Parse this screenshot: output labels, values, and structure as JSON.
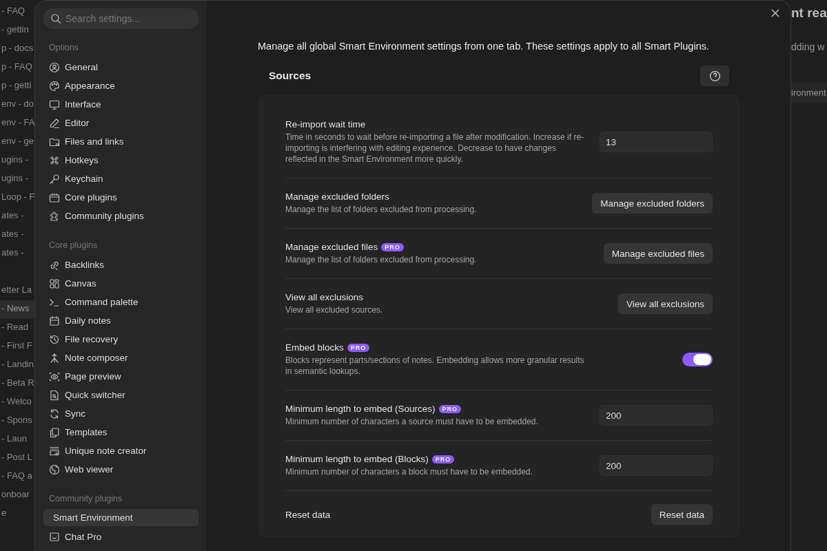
{
  "background_left": {
    "groups": [
      {
        "items": [
          {
            "label": "- FAQ",
            "selected": false
          },
          {
            "label": "- gettin",
            "selected": false
          },
          {
            "label": "p - docs",
            "selected": false
          },
          {
            "label": "p - FAQ",
            "selected": false
          },
          {
            "label": "p - getti",
            "selected": false
          },
          {
            "label": "env - do",
            "selected": false
          },
          {
            "label": "env - FA",
            "selected": false
          },
          {
            "label": "env - ge",
            "selected": false
          },
          {
            "label": "ugins -",
            "selected": false
          },
          {
            "label": "ugins -",
            "selected": false
          },
          {
            "label": "Loop - F",
            "selected": false
          },
          {
            "label": "ates -",
            "selected": false
          },
          {
            "label": "ates -",
            "selected": false
          },
          {
            "label": "ates -",
            "selected": false
          }
        ]
      },
      {
        "items": [
          {
            "label": "etter La",
            "selected": false
          },
          {
            "label": "- News",
            "selected": true
          },
          {
            "label": "- Read",
            "selected": false
          },
          {
            "label": "- First F",
            "selected": false
          },
          {
            "label": "- Landin",
            "selected": false
          },
          {
            "label": "- Beta R",
            "selected": false
          },
          {
            "label": "- Welco",
            "selected": false
          },
          {
            "label": "- Spons",
            "selected": false
          },
          {
            "label": "- Laun",
            "selected": false
          },
          {
            "label": "- Post L",
            "selected": false
          },
          {
            "label": "- FAQ a",
            "selected": false
          },
          {
            "label": "onboar",
            "selected": false
          },
          {
            "label": "e",
            "selected": false
          }
        ]
      }
    ]
  },
  "background_right": {
    "title": "nt rea",
    "text": "dding w",
    "field": "ironment"
  },
  "sidebar": {
    "search": {
      "placeholder": "Search settings..."
    },
    "sections": [
      {
        "title": "Options",
        "items": [
          {
            "label": "General",
            "selected": false
          },
          {
            "label": "Appearance",
            "selected": false
          },
          {
            "label": "Interface",
            "selected": false
          },
          {
            "label": "Editor",
            "selected": false
          },
          {
            "label": "Files and links",
            "selected": false
          },
          {
            "label": "Hotkeys",
            "selected": false
          },
          {
            "label": "Keychain",
            "selected": false
          },
          {
            "label": "Core plugins",
            "selected": false
          },
          {
            "label": "Community plugins",
            "selected": false
          }
        ]
      },
      {
        "title": "Core plugins",
        "items": [
          {
            "label": "Backlinks",
            "selected": false
          },
          {
            "label": "Canvas",
            "selected": false
          },
          {
            "label": "Command palette",
            "selected": false
          },
          {
            "label": "Daily notes",
            "selected": false
          },
          {
            "label": "File recovery",
            "selected": false
          },
          {
            "label": "Note composer",
            "selected": false
          },
          {
            "label": "Page preview",
            "selected": false
          },
          {
            "label": "Quick switcher",
            "selected": false
          },
          {
            "label": "Sync",
            "selected": false
          },
          {
            "label": "Templates",
            "selected": false
          },
          {
            "label": "Unique note creator",
            "selected": false
          },
          {
            "label": "Web viewer",
            "selected": false
          }
        ]
      },
      {
        "title": "Community plugins",
        "items": [
          {
            "label": "Smart Environment",
            "selected": true
          },
          {
            "label": "Chat Pro",
            "selected": false
          }
        ]
      }
    ]
  },
  "content": {
    "intro": "Manage all global Smart Environment settings from one tab. These settings apply to all Smart Plugins.",
    "section_title": "Sources",
    "settings": [
      {
        "kind": "input",
        "name": "Re-import wait time",
        "description": "Time in seconds to wait before re-importing a file after modification. Increase if re-importing is interfering with editing experience. Decrease to have changes reflected in the Smart Environment more quickly.",
        "value": "13"
      },
      {
        "kind": "button",
        "name": "Manage excluded folders",
        "description": "Manage the list of folders excluded from processing.",
        "button": "Manage excluded folders"
      },
      {
        "kind": "button",
        "name": "Manage excluded files",
        "badge": "PRO",
        "description": "Manage the list of folders excluded from processing.",
        "button": "Manage excluded files"
      },
      {
        "kind": "button",
        "name": "View all exclusions",
        "description": "View all excluded sources.",
        "button": "View all exclusions"
      },
      {
        "kind": "toggle",
        "name": "Embed blocks",
        "badge": "PRO",
        "description": "Blocks represent parts/sections of notes. Embedding allows more granular results in semantic lookups.",
        "on": true
      },
      {
        "kind": "input",
        "name": "Minimum length to embed (Sources)",
        "badge": "PRO",
        "description": "Minimum number of characters a source must have to be embedded.",
        "value": "200"
      },
      {
        "kind": "input",
        "name": "Minimum length to embed (Blocks)",
        "badge": "PRO",
        "description": "Minimum number of characters a block must have to be embedded.",
        "value": "200"
      },
      {
        "kind": "button",
        "name": "Reset data",
        "button": "Reset data"
      }
    ]
  }
}
